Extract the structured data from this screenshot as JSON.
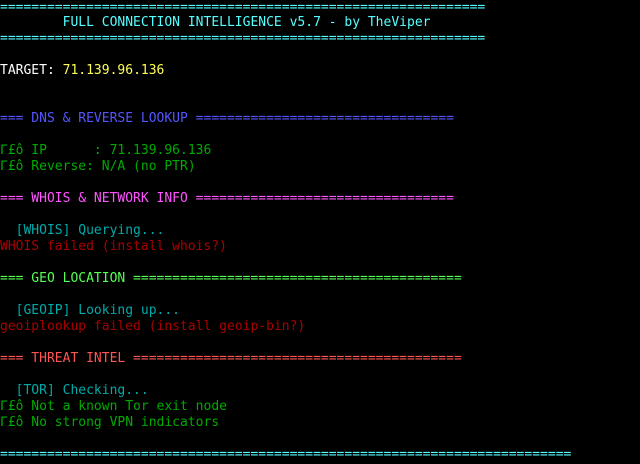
{
  "colors": {
    "background": "#000000",
    "banner": "#55ffff",
    "target_ip": "#ffff55",
    "dns_header": "#5555ff",
    "whois_header": "#ff55ff",
    "geo_header": "#55ff55",
    "threat_header": "#ff5555",
    "info": "#00aaaa",
    "ok": "#00aa00",
    "error": "#aa0000"
  },
  "banner": {
    "top_rule": "==============================================================",
    "title": "        FULL CONNECTION INTELLIGENCE v5.7 - by TheViper",
    "bottom_rule": "=============================================================="
  },
  "target": {
    "label": "TARGET: ",
    "ip": "71.139.96.136"
  },
  "dns": {
    "header": "=== DNS & REVERSE LOOKUP =================================",
    "ip_line": "Γ£ô IP      : 71.139.96.136",
    "reverse_line": "Γ£ô Reverse: N/A (no PTR)"
  },
  "whois": {
    "header": "=== WHOIS & NETWORK INFO =================================",
    "status": "  [WHOIS] Querying...",
    "error": "WHOIS failed (install whois?)"
  },
  "geo": {
    "header": "=== GEO LOCATION ==========================================",
    "status": "  [GEOIP] Looking up...",
    "error": "geoiplookup failed (install geoip-bin?)"
  },
  "threat": {
    "header": "=== THREAT INTEL ==========================================",
    "status": "  [TOR] Checking...",
    "tor_result": "Γ£ô Not a known Tor exit node",
    "vpn_result": "Γ£ô No strong VPN indicators"
  },
  "footer": {
    "rule": "========================================================================="
  }
}
